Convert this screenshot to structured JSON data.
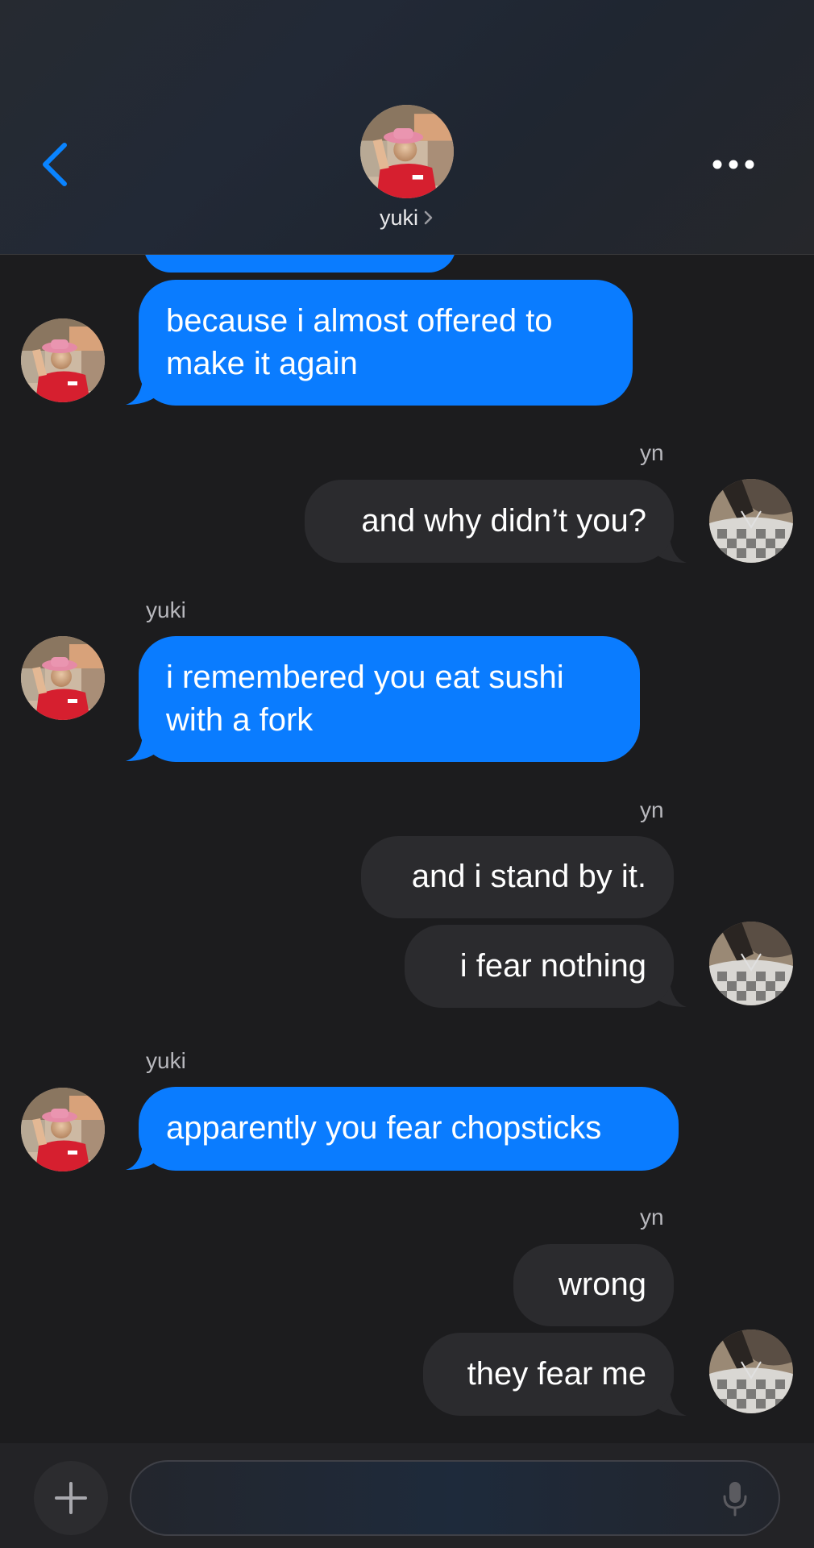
{
  "header": {
    "contact_name": "yuki",
    "back_icon": "chevron-left-icon",
    "more_icon": "ellipsis-icon",
    "name_chevron_icon": "chevron-right-icon"
  },
  "colors": {
    "incoming_bubble": "#0a7cff",
    "outgoing_bubble": "#2b2b2e",
    "background": "#1c1c1e",
    "accent": "#0a84ff"
  },
  "messages": [
    {
      "from": "yuki",
      "text_lines": [
        "because i almost offered to",
        "make it again"
      ]
    },
    {
      "from": "yn",
      "sender_label": "yn",
      "text": "and why didn’t you?"
    },
    {
      "from": "yuki",
      "sender_label": "yuki",
      "text_lines": [
        "i remembered you eat sushi",
        "with a fork"
      ]
    },
    {
      "from": "yn",
      "sender_label": "yn",
      "text": "and i stand by it."
    },
    {
      "from": "yn",
      "text": "i fear nothing"
    },
    {
      "from": "yuki",
      "sender_label": "yuki",
      "text": "apparently you fear chopsticks"
    },
    {
      "from": "yn",
      "sender_label": "yn",
      "text": "wrong"
    },
    {
      "from": "yn",
      "text": "they fear me"
    }
  ],
  "composer": {
    "placeholder": "",
    "add_icon": "plus-icon",
    "mic_icon": "microphone-icon"
  }
}
